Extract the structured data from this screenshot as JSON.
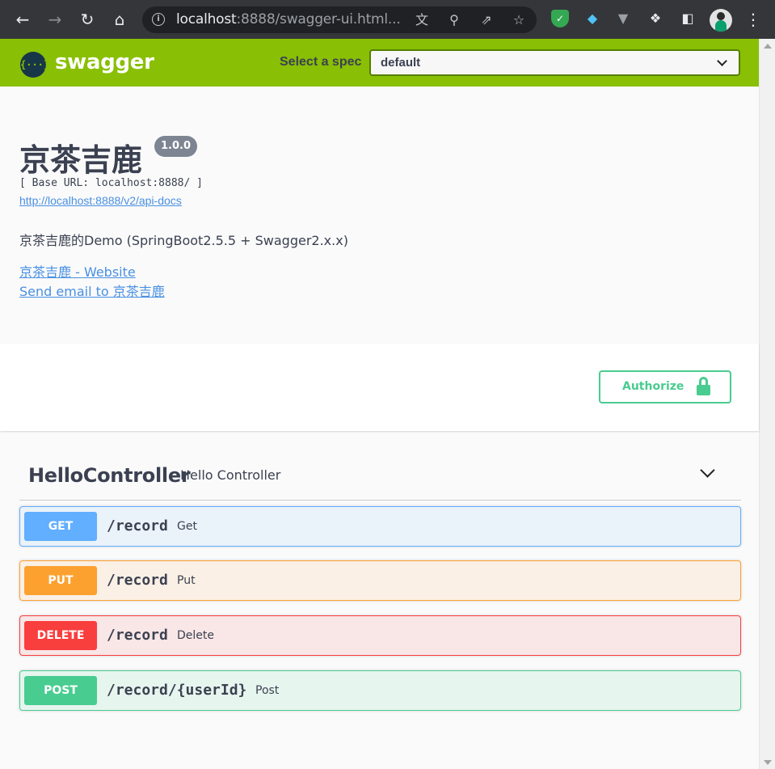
{
  "browser": {
    "url_host": "localhost",
    "url_rest": ":8888/swagger-ui.html...",
    "back_icon": "arrow-left-icon",
    "forward_icon": "arrow-right-icon",
    "reload_icon": "reload-icon",
    "home_icon": "home-icon"
  },
  "topbar": {
    "logo_text": "swagger",
    "logo_glyph": "{···}",
    "spec_label": "Select a spec",
    "spec_value": "default"
  },
  "info": {
    "title": "京茶吉鹿",
    "version": "1.0.0",
    "base_url": "[ Base URL: localhost:8888/ ]",
    "api_docs_link": "http://localhost:8888/v2/api-docs",
    "description": "京茶吉鹿的Demo (SpringBoot2.5.5 + Swagger2.x.x)",
    "website_link": "京茶吉鹿 - Website",
    "email_link": "Send email to 京茶吉鹿"
  },
  "scheme": {
    "authorize_label": "Authorize"
  },
  "tag": {
    "name": "HelloController",
    "description": "Hello Controller"
  },
  "operations": [
    {
      "method": "GET",
      "path": "/record",
      "summary": "Get",
      "color": "#61affe"
    },
    {
      "method": "PUT",
      "path": "/record",
      "summary": "Put",
      "color": "#fca130"
    },
    {
      "method": "DELETE",
      "path": "/record",
      "summary": "Delete",
      "color": "#f93e3e"
    },
    {
      "method": "POST",
      "path": "/record/{userId}",
      "summary": "Post",
      "color": "#49cc90"
    }
  ],
  "colors": {
    "topbar": "#89bf04",
    "text": "#3b4151",
    "link": "#4990e2",
    "authorize": "#49cc90"
  }
}
